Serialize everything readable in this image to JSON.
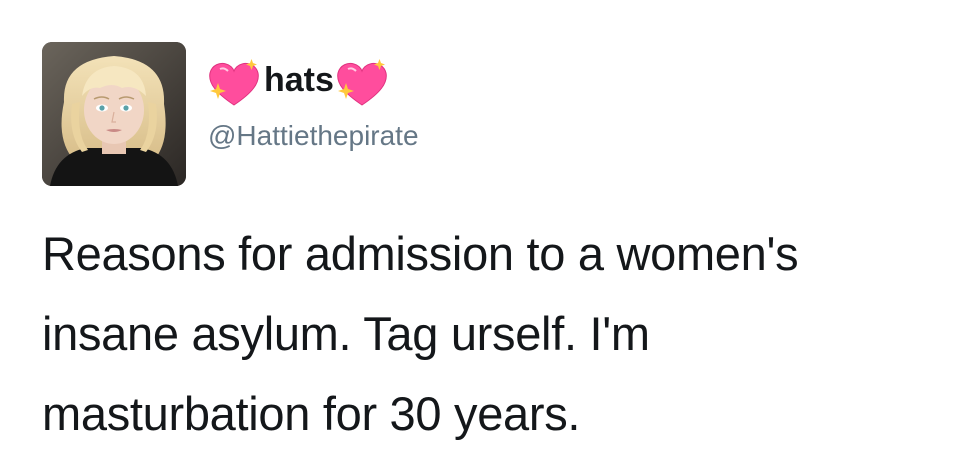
{
  "tweet": {
    "author": {
      "display_name": "hats",
      "name_decoration_icon": "sparkling-heart-icon",
      "handle": "@Hattiethepirate",
      "avatar": "profile-photo"
    },
    "text_lines": [
      "Reasons for admission to a women's",
      "insane asylum. Tag urself. I'm",
      "masturbation for 30 years."
    ]
  },
  "colors": {
    "text": "#14171a",
    "handle": "#657786",
    "heart": "#ff4d9d",
    "sparkle": "#ffc93c",
    "background": "#ffffff"
  }
}
